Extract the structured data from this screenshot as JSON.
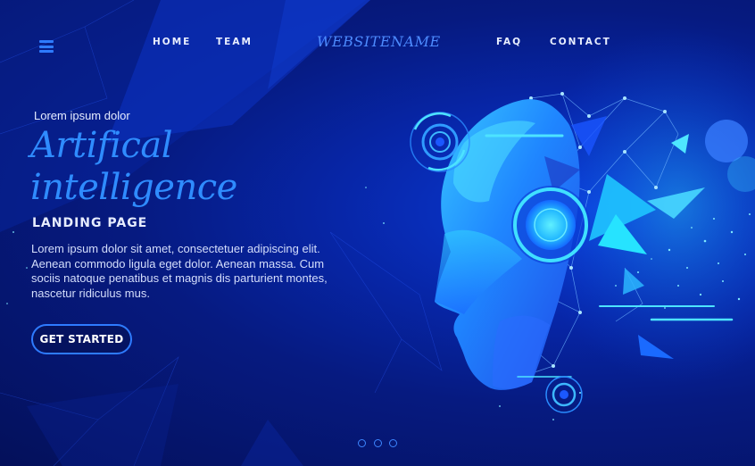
{
  "nav": {
    "home": "HOME",
    "team": "TEAM",
    "site_name": "WEBSITENAME",
    "faq": "FAQ",
    "contact": "CONTACT"
  },
  "hero": {
    "eyebrow": "Lorem ipsum dolor",
    "title_line_1": "Artifical",
    "title_line_2": "intelligence",
    "subtitle": "LANDING PAGE",
    "body": "Lorem ipsum dolor sit amet, consectetuer adipiscing elit. Aenean commodo ligula eget dolor. Aenean massa. Cum sociis natoque penatibus et magnis dis parturient montes, nascetur ridiculus mus.",
    "cta_label": "GET STARTED"
  },
  "pager": {
    "count": 3
  },
  "icons": {
    "menu": "hamburger-menu-icon",
    "illustration": "ai-head-illustration"
  },
  "colors": {
    "background": "#05125a",
    "accent": "#2e7bff",
    "title": "#2f8cff",
    "text": "#e6ecff"
  }
}
